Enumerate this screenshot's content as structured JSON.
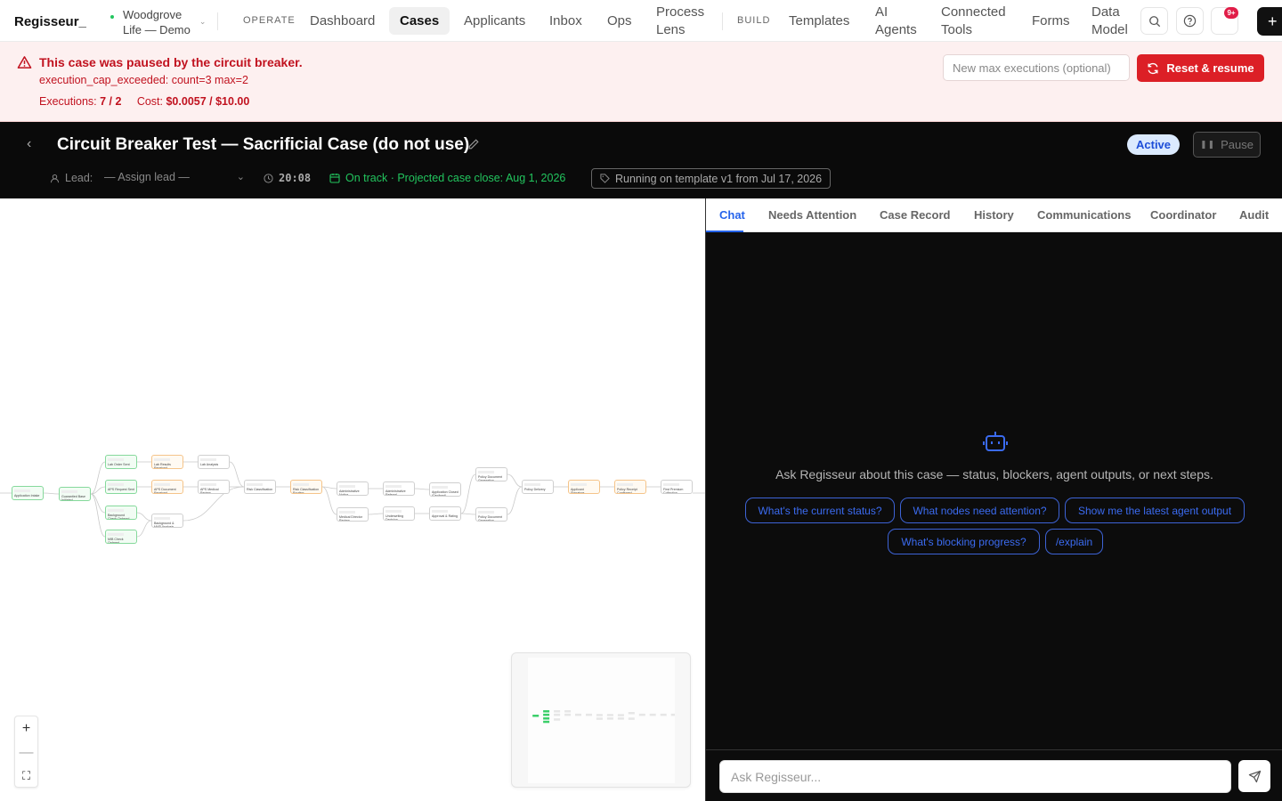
{
  "app": {
    "logo": "Regisseur_"
  },
  "workspace": {
    "name_line1": "Woodgrove",
    "name_line2": "Life — Demo"
  },
  "nav": {
    "operate_label": "OPERATE",
    "build_label": "BUILD",
    "dashboard": "Dashboard",
    "cases": "Cases",
    "applicants": "Applicants",
    "inbox": "Inbox",
    "ops": "Ops",
    "process_lens_1": "Process",
    "process_lens_2": "Lens",
    "templates": "Templates",
    "ai_agents_1": "AI",
    "ai_agents_2": "Agents",
    "connected_tools_1": "Connected",
    "connected_tools_2": "Tools",
    "forms": "Forms",
    "data_model_1": "Data",
    "data_model_2": "Model",
    "notification_badge": "9+",
    "new_symbol": "+"
  },
  "alert": {
    "title": "This case was paused by the circuit breaker.",
    "code": "execution_cap_exceeded: count=3 max=2",
    "executions_label": "Executions:",
    "executions_value": "7 / 2",
    "cost_label": "Cost:",
    "cost_value": "$0.0057 / $10.00",
    "input_placeholder": "New max executions (optional)",
    "reset_button": "Reset & resume",
    "accent_color": "#dc1f26"
  },
  "case": {
    "title": "Circuit Breaker Test — Sacrificial Case (do not use)",
    "status": "Active",
    "pause_button": "Pause",
    "lead_label": "Lead:",
    "lead_value": "— Assign lead —",
    "timer": "20:08",
    "on_track": "On track · Projected case close: Aug 1, 2026",
    "template": "Running on template v1 from Jul 17, 2026"
  },
  "graph": {
    "nodes": [
      {
        "label": "Application Intake",
        "state": "done"
      },
      {
        "label": "Guarantied Base Initiated",
        "state": "done"
      },
      {
        "label": "Lab Order Sent",
        "state": "done"
      },
      {
        "label": "APS Request Sent",
        "state": "done"
      },
      {
        "label": "Background Check Ordered",
        "state": "done"
      },
      {
        "label": "MIB Check Ordered",
        "state": "done"
      },
      {
        "label": "Lab Results Received",
        "state": "waiting"
      },
      {
        "label": "APS Document Received",
        "state": "waiting"
      },
      {
        "label": "Background & MVR Analysis",
        "state": "pending"
      },
      {
        "label": "Lab Analysis",
        "state": "pending"
      },
      {
        "label": "APS Medical Review",
        "state": "pending"
      },
      {
        "label": "Risk Classification",
        "state": "pending"
      },
      {
        "label": "Risk Classification Routing",
        "state": "waiting"
      },
      {
        "label": "Administrative Notice",
        "state": "pending"
      },
      {
        "label": "Medical Director Review",
        "state": "pending"
      },
      {
        "label": "Administrative Referral",
        "state": "pending"
      },
      {
        "label": "Underwriting Decision",
        "state": "pending"
      },
      {
        "label": "Application Closed (Declined)",
        "state": "pending"
      },
      {
        "label": "Approval & Rating",
        "state": "pending"
      },
      {
        "label": "Policy Document Generation (Preferred Plus)",
        "state": "pending"
      },
      {
        "label": "Policy Document Generation (Standard)",
        "state": "pending"
      },
      {
        "label": "Policy Delivery",
        "state": "pending"
      },
      {
        "label": "Applicant Signature",
        "state": "waiting"
      },
      {
        "label": "Policy Receipt Confirmed",
        "state": "waiting"
      },
      {
        "label": "First Premium Collection",
        "state": "pending"
      }
    ]
  },
  "panel": {
    "tabs": [
      "Chat",
      "Needs Attention",
      "Case Record",
      "History",
      "Communications",
      "Coordinator",
      "Audit"
    ],
    "empty_text": "Ask Regisseur about this case — status, blockers, agent outputs, or next steps.",
    "suggestions": [
      "What's the current status?",
      "What nodes need attention?",
      "Show me the latest agent output",
      "What's blocking progress?",
      "/explain"
    ],
    "chat_placeholder": "Ask Regisseur...",
    "accent_color": "#2563eb"
  },
  "icons": {
    "alert": "warning-triangle-icon",
    "reset": "refresh-icon",
    "search": "search-icon",
    "help": "help-circle-icon",
    "bell": "bell-icon",
    "edit": "pencil-icon",
    "user": "user-icon",
    "clock": "clock-icon",
    "calendar": "calendar-icon",
    "tag": "tag-icon",
    "bot": "bot-icon",
    "send": "send-icon"
  }
}
